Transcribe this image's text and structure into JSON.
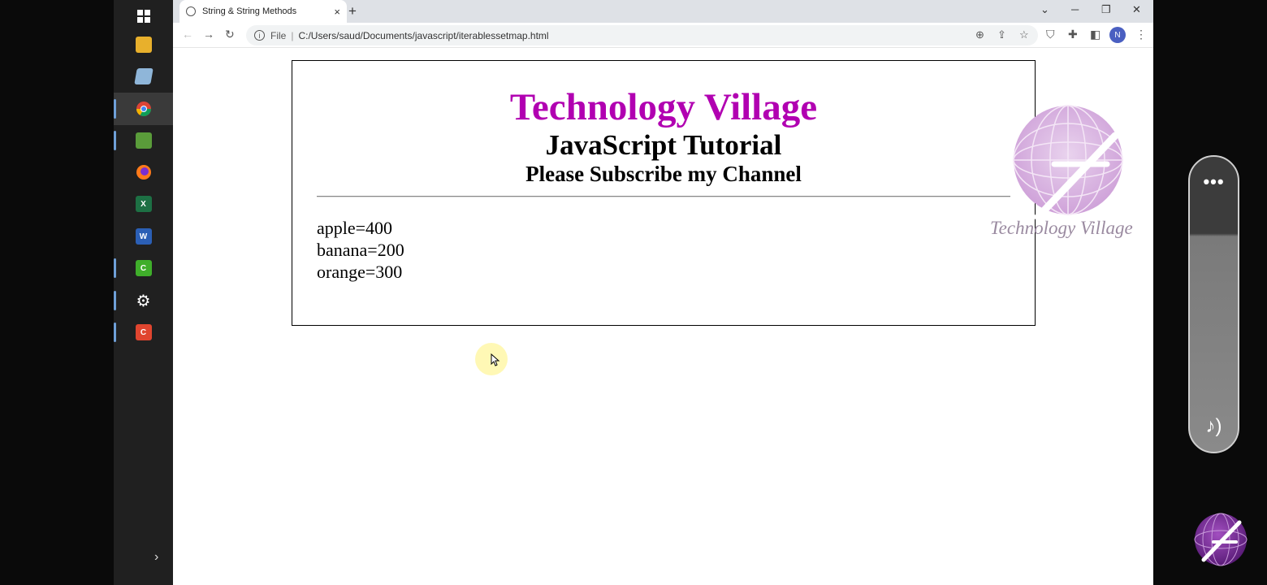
{
  "browser": {
    "tab_title": "String & String Methods",
    "tab_close": "×",
    "new_tab": "+",
    "address_prefix": "File",
    "address_sep": "|",
    "url": "C:/Users/saud/Documents/javascript/iterablessetmap.html",
    "profile_initial": "N"
  },
  "page": {
    "heading": "Technology Village",
    "subheading": "JavaScript Tutorial",
    "subscribe": "Please Subscribe my Channel",
    "output": [
      "apple=400",
      "banana=200",
      "orange=300"
    ],
    "watermark_text": "Technology Village"
  },
  "taskbar": {
    "apps": [
      "windows-start",
      "file-explorer",
      "notepad-app",
      "chrome",
      "image-editor",
      "firefox",
      "excel",
      "word",
      "camtasia",
      "settings",
      "camtasia-recorder"
    ]
  },
  "colors": {
    "heading": "#b100b1",
    "taskbar": "#202020"
  }
}
